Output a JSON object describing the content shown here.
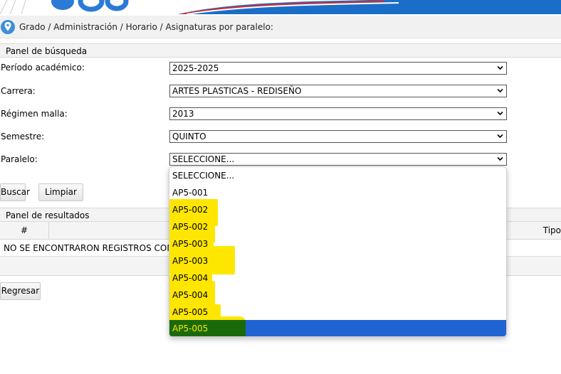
{
  "colors": {
    "selected_option_bg": "#1f64d2",
    "highlight_marker": "#ffe600",
    "location_pin": "#3d8fd8"
  },
  "breadcrumb": {
    "icon": "location-pin-icon",
    "text": "Grado / Administración / Horario / Asignaturas por paralelo:"
  },
  "search_panel": {
    "title": "Panel de búsqueda",
    "fields": [
      {
        "label": "Período académico:",
        "value": "2025-2025"
      },
      {
        "label": "Carrera:",
        "value": "ARTES PLASTICAS - REDISEÑO"
      },
      {
        "label": "Régimen malla:",
        "value": "2013"
      },
      {
        "label": "Semestre:",
        "value": "QUINTO"
      },
      {
        "label": "Paralelo:",
        "value": "SELECCIONE..."
      }
    ],
    "buttons": {
      "search": "Buscar",
      "clear": "Limpiar"
    }
  },
  "paralelo_dropdown": {
    "options": [
      "SELECCIONE...",
      "AP5-001",
      "AP5-002",
      "AP5-002",
      "AP5-003",
      "AP5-003",
      "AP5-004",
      "AP5-004",
      "AP5-005",
      "AP5-005"
    ],
    "selected_index": 9
  },
  "results_panel": {
    "title": "Panel de resultados",
    "columns": {
      "number": "#",
      "type": "Tipo"
    },
    "empty_message": "NO SE ENCONTRARON REGISTROS CON LOS"
  },
  "footer": {
    "back_button": "Regresar"
  }
}
